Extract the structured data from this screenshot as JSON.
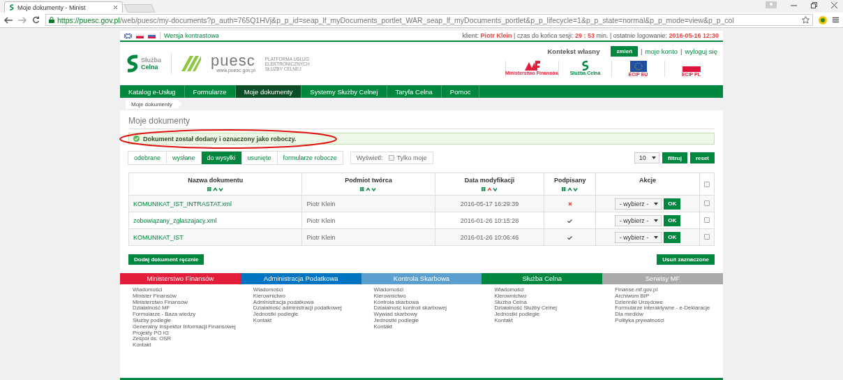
{
  "browser": {
    "tab_title": "Moje dokumenty - Minist",
    "url_host": "https://puesc.gov.pl",
    "url_path": "/web/puesc/my-documents?p_auth=765Q1HVj&p_p_id=seap_lf_myDocuments_portlet_WAR_seap_lf_myDocuments_portlet&p_p_lifecycle=1&p_p_state=normal&p_p_mode=view&p_p_col"
  },
  "topbar": {
    "contrast_link": "Wersja kontrastowa",
    "client_label": "klient:",
    "client_name": "Piotr Klein",
    "timer_label": "| czas do końca sesji:",
    "timer": "29 : 53",
    "last_login_label": "min. | ostatnie logowanie:",
    "last_login": "2016-05-16 12:30"
  },
  "header": {
    "logo_text": [
      "Służba",
      "Celna"
    ],
    "puesc_logo": "puesc",
    "puesc_url": "www.puesc.gov.pl",
    "platform_text": "PLATFORMA USŁUG ELEKTRONICZNYCH SŁUŻBY CELNEJ",
    "context_label": "Kontekst własny",
    "change_button": "zmień",
    "account_links": [
      {
        "separator": "|",
        "label": "moje konto"
      },
      {
        "separator": "|",
        "label": "wyloguj się"
      }
    ],
    "partner_logos": [
      {
        "kind": "mf",
        "caption": "Ministerstwo Finansów"
      },
      {
        "kind": "sc",
        "caption": "Służba Celna"
      },
      {
        "kind": "eu",
        "caption": "ECIP EU"
      },
      {
        "kind": "pl",
        "caption": "ECIP PL"
      }
    ]
  },
  "nav": [
    {
      "label": "Katalog e-Usług",
      "selected": false
    },
    {
      "label": "Formularze",
      "selected": false
    },
    {
      "label": "Moje dokumenty",
      "selected": true
    },
    {
      "label": "Systemy Służby Celnej",
      "selected": false
    },
    {
      "label": "Taryfa Celna",
      "selected": false
    },
    {
      "label": "Pomoc",
      "selected": false
    }
  ],
  "breadcrumb": "Moje dokumenty",
  "page_title": "Moje dokumenty",
  "message": "Dokument został dodany i oznaczony jako roboczy.",
  "tabs": [
    {
      "label": "odebrane",
      "selected": false
    },
    {
      "label": "wysłane",
      "selected": false
    },
    {
      "label": "do wysyłki",
      "selected": true
    },
    {
      "label": "usunięte",
      "selected": false
    },
    {
      "label": "formularze robocze",
      "selected": false
    }
  ],
  "display_filter": {
    "label": "Wyświetl:",
    "checkbox_label": "Tylko moje",
    "checked": false
  },
  "page_size": "10",
  "filter_button": "filtruj",
  "reset_button": "reset",
  "table": {
    "columns": [
      {
        "label": "Nazwa dokumentu",
        "sortable": true,
        "sort_active": false
      },
      {
        "label": "Podmiot twórca",
        "sortable": true,
        "sort_active": false
      },
      {
        "label": "Data modyfikacji",
        "sortable": true,
        "sort_active": true
      },
      {
        "label": "Podpisany",
        "sortable": true,
        "sort_active": false
      },
      {
        "label": "Akcje",
        "sortable": false
      }
    ],
    "select_all_checked": false,
    "rows": [
      {
        "name": "KOMUNIKAT_IST_INTRASTAT.xml",
        "creator": "Piotr Klein",
        "modified": "2016-05-17 16:29:39",
        "signed": false,
        "action": "- wybierz -",
        "ok": "OK",
        "checked": false
      },
      {
        "name": "zobowiązany_zglaszajacy.xml",
        "creator": "Piotr Klein",
        "modified": "2016-01-26 10:15:28",
        "signed": true,
        "action": "- wybierz -",
        "ok": "OK",
        "checked": false
      },
      {
        "name": "KOMUNIKAT_IST",
        "creator": "Piotr Klein",
        "modified": "2016-01-26 10:06:46",
        "signed": true,
        "action": "- wybierz -",
        "ok": "OK",
        "checked": false
      }
    ]
  },
  "add_button": "Dodaj dokument ręcznie",
  "delete_button": "Usuń zaznaczone",
  "footer": [
    {
      "title": "Ministerstwo Finansów",
      "color": "#e31e3a",
      "links": [
        "Wiadomości",
        "Minister Finansów",
        "Ministerstwo Finansów",
        "Działalność MF",
        "Formularze - Baza wiedzy",
        "Służby podległe",
        "Generalny Inspektor Informacji Finansowej",
        "Projekty PO IG",
        "Zespół ds. OSR",
        "Kontakt"
      ]
    },
    {
      "title": "Administracja Podatkowa",
      "color": "#0074c1",
      "links": [
        "Wiadomości",
        "Kierownictwo",
        "Administracja podatkowa",
        "Działalność administracji podatkowej",
        "Jednostki podległe",
        "Kontakt"
      ]
    },
    {
      "title": "Kontrola Skarbowa",
      "color": "#5a9fd0",
      "links": [
        "Wiadomości",
        "Kierownictwo",
        "Kontrola skarbowa",
        "Działalność kontroli skarbowej",
        "Wywiad skarbowy",
        "Jednostki podległe",
        "Kontakt"
      ]
    },
    {
      "title": "Służba Celna",
      "color": "#00873f",
      "links": [
        "Wiadomości",
        "Kierownictwo",
        "Służba Celna",
        "Działalność Służby Celnej",
        "Jednostki podległe",
        "Kontakt"
      ]
    },
    {
      "title": "Serwisy MF",
      "color": "#aaaaaa",
      "links": [
        "Finanse.mf.gov.pl",
        "Archiwum BIP",
        "Dzienniki Urzędowe",
        "Formularze interaktywne - e-Deklaracje",
        "Dla mediów",
        "Polityka prywatności"
      ]
    }
  ]
}
